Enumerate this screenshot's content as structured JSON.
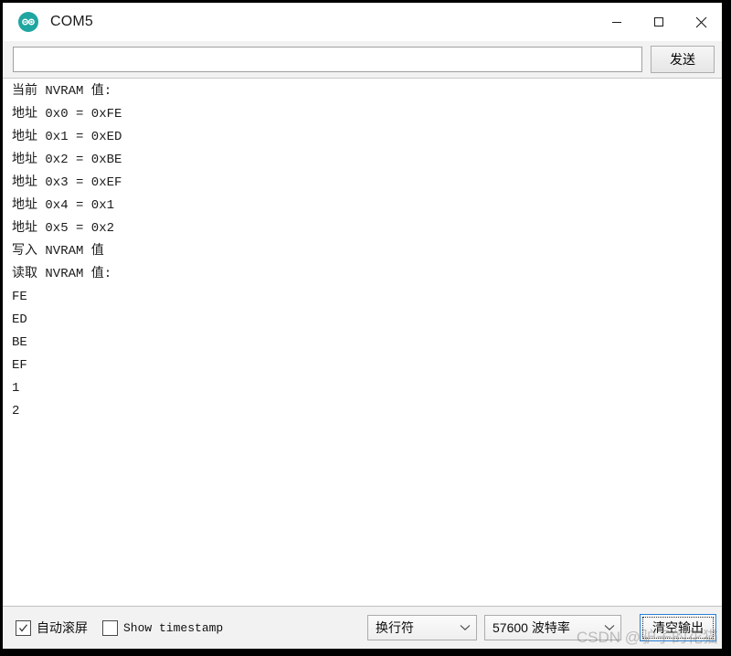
{
  "window": {
    "title": "COM5",
    "app_icon": "arduino-infinity-icon",
    "accent_color": "#1fa6a0",
    "focus_border_color": "#2a7fd4",
    "controls": {
      "minimize": "minimize-icon",
      "maximize": "maximize-icon",
      "close": "close-icon"
    }
  },
  "send_row": {
    "input_value": "",
    "input_placeholder": "",
    "send_label": "发送"
  },
  "console": {
    "lines": [
      "当前 NVRAM 值:",
      "地址 0x0 = 0xFE",
      "地址 0x1 = 0xED",
      "地址 0x2 = 0xBE",
      "地址 0x3 = 0xEF",
      "地址 0x4 = 0x1",
      "地址 0x5 = 0x2",
      "写入 NVRAM 值",
      "读取 NVRAM 值:",
      "FE",
      "ED",
      "BE",
      "EF",
      "1",
      "2"
    ],
    "text": "当前 NVRAM 值:\n地址 0x0 = 0xFE\n地址 0x1 = 0xED\n地址 0x2 = 0xBE\n地址 0x3 = 0xEF\n地址 0x4 = 0x1\n地址 0x5 = 0x2\n写入 NVRAM 值\n读取 NVRAM 值:\nFE\nED\nBE\nEF\n1\n2"
  },
  "status_bar": {
    "autoscroll_label": "自动滚屏",
    "autoscroll_checked": true,
    "timestamp_label": "Show timestamp",
    "timestamp_checked": false,
    "newline_value": "换行符",
    "baud_value": "57600 波特率",
    "clear_label": "清空输出"
  },
  "watermark": {
    "text": "CSDN @驴子的花猫"
  }
}
